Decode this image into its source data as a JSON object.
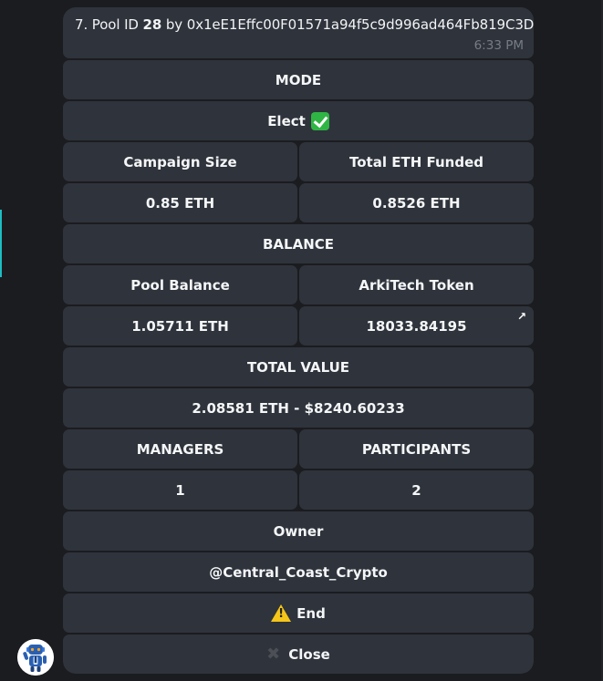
{
  "message": {
    "index_prefix": "7. Pool ID ",
    "pool_id": "28",
    "by_text": " by ",
    "address": "0x1eE1Effc00F01571a94f5c9d996ad464Fb819C3D",
    "time": "6:33 PM"
  },
  "keyboard": {
    "mode_label": "MODE",
    "mode_value": "Elect",
    "mode_value_icon": "check-mark-button-icon",
    "campaign_size_label": "Campaign Size",
    "total_eth_funded_label": "Total ETH Funded",
    "campaign_size_value": "0.85 ETH",
    "total_eth_funded_value": "0.8526 ETH",
    "balance_label": "BALANCE",
    "pool_balance_label": "Pool Balance",
    "token_label": "ArkiTech Token",
    "pool_balance_value": "1.05711 ETH",
    "token_value": "18033.84195",
    "token_link_icon": "external-link-arrow-icon",
    "total_value_label": "TOTAL VALUE",
    "total_value_value": "2.08581 ETH - $8240.60233",
    "managers_label": "MANAGERS",
    "participants_label": "PARTICIPANTS",
    "managers_value": "1",
    "participants_value": "2",
    "owner_label": "Owner",
    "owner_value": "@Central_Coast_Crypto",
    "end_label": "End",
    "end_icon": "warning-icon",
    "close_label": "Close",
    "close_icon": "cross-mark-icon"
  },
  "colors": {
    "background": "#1b1c20",
    "bubble": "#2f333b",
    "button": "#2f333b",
    "accent": "#1fbcc4",
    "timestamp": "#767d87",
    "check_green": "#2fb544",
    "warning_yellow": "#f5c518"
  },
  "avatar": {
    "icon": "robot-avatar-icon"
  }
}
